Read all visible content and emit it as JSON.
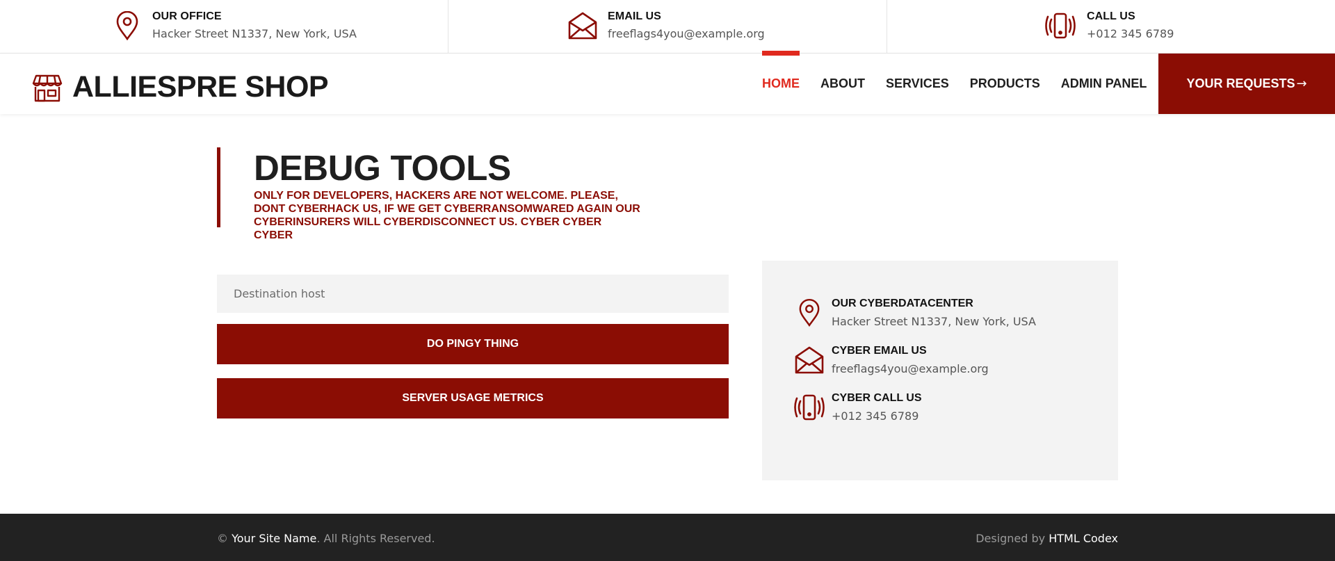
{
  "topbar": {
    "office": {
      "title": "OUR OFFICE",
      "value": "Hacker Street N1337, New York, USA",
      "icon": "map-pin-icon"
    },
    "email": {
      "title": "EMAIL US",
      "value": "freeflags4you@example.org",
      "icon": "envelope-icon"
    },
    "call": {
      "title": "CALL US",
      "value": "+012 345 6789",
      "icon": "phone-vibrate-icon"
    }
  },
  "brand": {
    "name": "ALLIESPRE SHOP",
    "icon": "storefront-icon"
  },
  "nav": {
    "items": [
      {
        "label": "HOME",
        "active": true
      },
      {
        "label": "ABOUT"
      },
      {
        "label": "SERVICES"
      },
      {
        "label": "PRODUCTS"
      },
      {
        "label": "ADMIN PANEL"
      }
    ],
    "cta_label": "YOUR REQUESTS",
    "cta_arrow": "→"
  },
  "main": {
    "title": "DEBUG TOOLS",
    "warning": "ONLY FOR DEVELOPERS, HACKERS ARE NOT WELCOME. PLEASE, DONT CYBERHACK US, IF WE GET CYBERRANSOMWARED AGAIN OUR CYBERINSURERS WILL CYBERDISCONNECT US. CYBER CYBER CYBER",
    "host_placeholder": "Destination host",
    "ping_button": "DO PINGY THING",
    "metrics_button": "SERVER USAGE METRICS"
  },
  "contact_box": {
    "datacenter": {
      "title": "OUR CYBERDATACENTER",
      "value": "Hacker Street N1337, New York, USA"
    },
    "email": {
      "title": "CYBER EMAIL US",
      "value": "freeflags4you@example.org"
    },
    "call": {
      "title": "CYBER CALL US",
      "value": "+012 345 6789"
    }
  },
  "footer": {
    "copyright_symbol": "©",
    "site_name": "Your Site Name",
    "rights": ". All Rights Reserved.",
    "designed_by": "Designed by",
    "designer": "HTML Codex"
  },
  "colors": {
    "brand_red": "#8b0d04",
    "active_red": "#e02a1f",
    "footer_bg": "#222222",
    "panel_bg": "#f3f3f3"
  }
}
